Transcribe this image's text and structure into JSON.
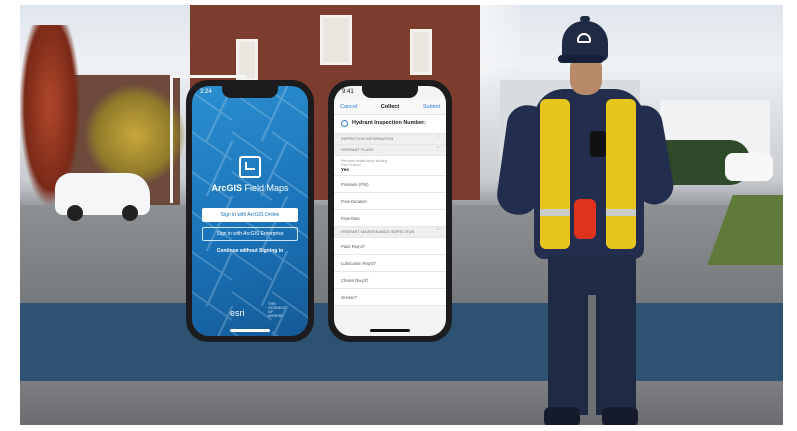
{
  "phone_login": {
    "status_time": "3:24",
    "app_name_bold": "ArcGIS",
    "app_name_rest": " Field Maps",
    "sign_in_online": "Sign in with ArcGIS Online",
    "sign_in_enterprise": "Sign in with ArcGIS Enterprise",
    "continue_label": "Continue without Signing in",
    "brand": "esri",
    "brand_tagline": "THE SCIENCE OF WHERE"
  },
  "phone_form": {
    "status_time": "9:41",
    "cancel_label": "Cancel",
    "title": "Collect",
    "submit_label": "Submit",
    "form_title": "Hydrant Inspection Number:",
    "rows": [
      {
        "kind": "section",
        "text": "INSPECTION INFORMATION"
      },
      {
        "kind": "section",
        "text": "HYDRANT FLUSH"
      },
      {
        "kind": "value",
        "label": "Recorded details about flushing",
        "sub": "Flow Flushed",
        "value": "Yes"
      },
      {
        "kind": "field",
        "label": "Pressure (PSI)"
      },
      {
        "kind": "field",
        "label": "Flow Duration"
      },
      {
        "kind": "field",
        "label": "Flow Rate"
      },
      {
        "kind": "section",
        "text": "HYDRANT MAINTENANCE INSPECTION"
      },
      {
        "kind": "field",
        "label": "Paint Req'd?"
      },
      {
        "kind": "field",
        "label": "Lubrication Req'd?"
      },
      {
        "kind": "field",
        "label": "Chains Req'd?"
      },
      {
        "kind": "field",
        "label": "Grease?"
      }
    ]
  },
  "colors": {
    "band": "#2e5372",
    "login_blue": "#1a73b8",
    "form_accent": "#2f7bd6",
    "vest": "#e8c51c"
  },
  "icons": {
    "login_logo": "field-maps-logo-icon",
    "form_header": "link-icon",
    "section_chevron": "chevron-up-icon"
  }
}
